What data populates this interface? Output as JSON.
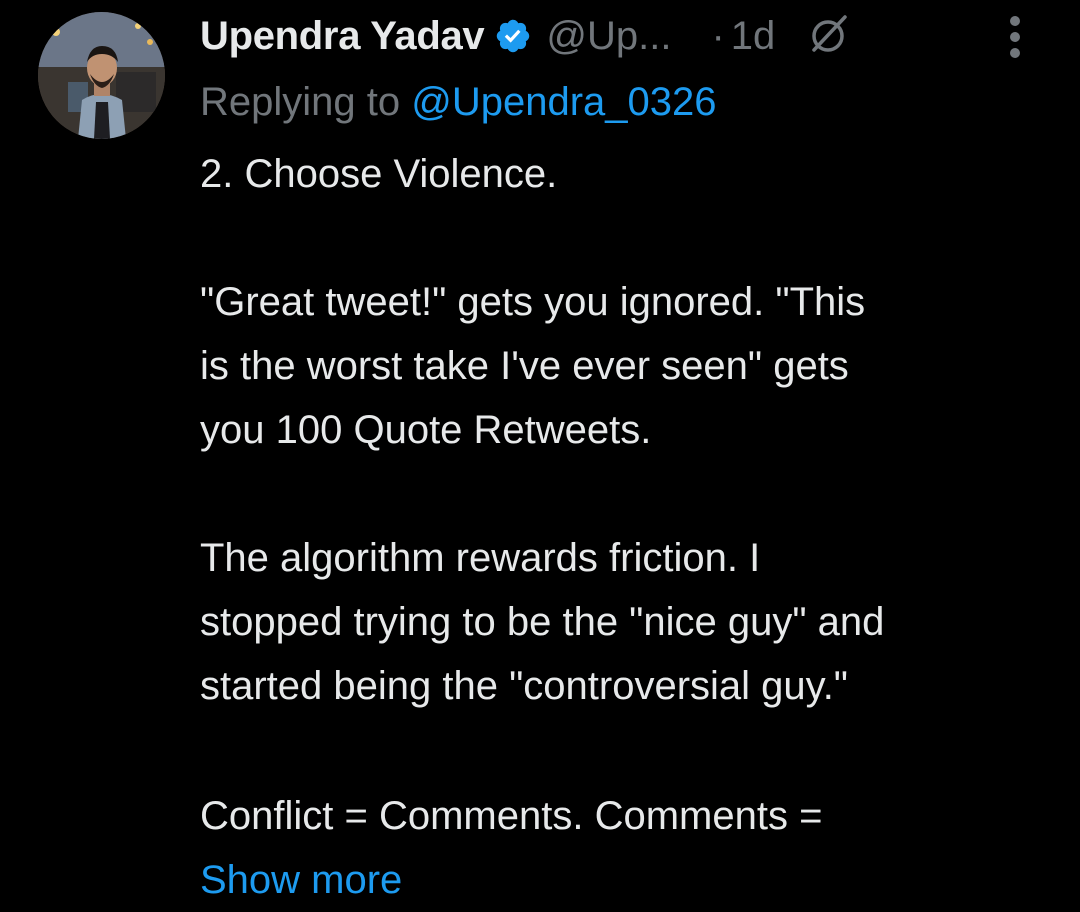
{
  "tweet": {
    "author": {
      "name": "Upendra Yadav",
      "handle": "@Up...",
      "verified": true,
      "avatar_icon": "profile-photo"
    },
    "separator": "·",
    "time": "1d",
    "replying_prefix": "Replying to ",
    "replying_to": "@Upendra_0326",
    "body": {
      "line1": "2. Choose Violence.",
      "p2_line1": "\"Great tweet!\" gets you ignored. \"This",
      "p2_line2": "is the worst take I've ever seen\" gets",
      "p2_line3": "you 100 Quote Retweets.",
      "p3_line1": "The algorithm rewards friction. I",
      "p3_line2": "stopped trying to be the \"nice guy\" and",
      "p3_line3": "started being the \"controversial guy.\"",
      "p4_line1": "Conflict = Comments. Comments ="
    },
    "show_more": "Show more"
  },
  "colors": {
    "background": "#000000",
    "text": "#e7e9ea",
    "muted": "#71767b",
    "accent": "#1d9bf0"
  }
}
